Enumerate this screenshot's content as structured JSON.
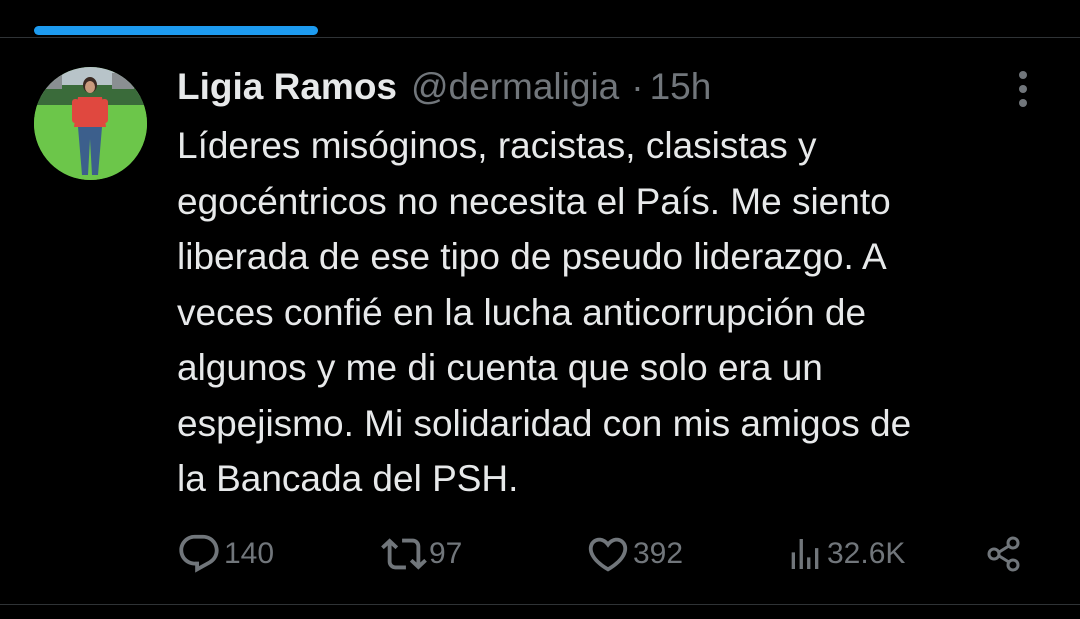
{
  "tweet": {
    "display_name": "Ligia Ramos",
    "handle": "@dermaligia",
    "separator": "·",
    "time": "15h",
    "text": "Líderes misóginos, racistas, clasistas y\negocéntricos no necesita el País. Me siento\nliberada de ese tipo de pseudo liderazgo. A\nveces confié en la lucha anticorrupción de\nalgunos y me di cuenta que solo era un\nespejismo. Mi solidaridad con mis amigos de\nla Bancada del PSH."
  },
  "actions": {
    "replies": "140",
    "retweets": "97",
    "likes": "392",
    "views": "32.6K"
  },
  "icons": {
    "more": "more-vertical-icon",
    "reply": "reply-icon",
    "retweet": "retweet-icon",
    "like": "heart-icon",
    "views": "views-bar-chart-icon",
    "share": "share-icon"
  },
  "colors": {
    "background": "#000000",
    "primary_text": "#e7e9ea",
    "secondary_text": "#71767b",
    "accent": "#1d9bf0",
    "divider": "#2f3336"
  }
}
